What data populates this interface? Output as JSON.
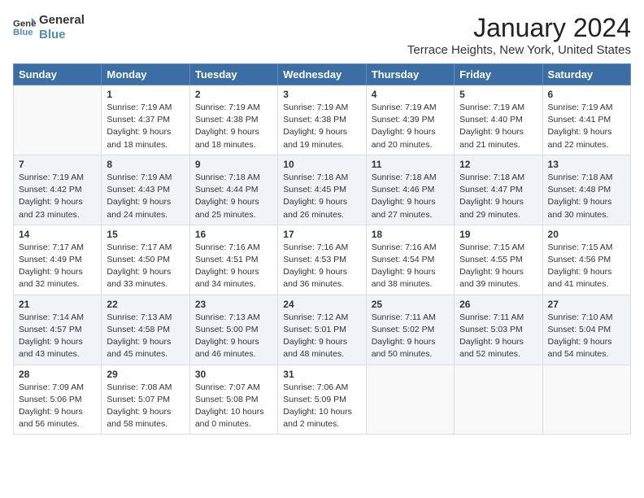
{
  "logo": {
    "line1": "General",
    "line2": "Blue"
  },
  "title": "January 2024",
  "location": "Terrace Heights, New York, United States",
  "weekdays": [
    "Sunday",
    "Monday",
    "Tuesday",
    "Wednesday",
    "Thursday",
    "Friday",
    "Saturday"
  ],
  "weeks": [
    [
      {
        "day": "",
        "info": ""
      },
      {
        "day": "1",
        "info": "Sunrise: 7:19 AM\nSunset: 4:37 PM\nDaylight: 9 hours\nand 18 minutes."
      },
      {
        "day": "2",
        "info": "Sunrise: 7:19 AM\nSunset: 4:38 PM\nDaylight: 9 hours\nand 18 minutes."
      },
      {
        "day": "3",
        "info": "Sunrise: 7:19 AM\nSunset: 4:38 PM\nDaylight: 9 hours\nand 19 minutes."
      },
      {
        "day": "4",
        "info": "Sunrise: 7:19 AM\nSunset: 4:39 PM\nDaylight: 9 hours\nand 20 minutes."
      },
      {
        "day": "5",
        "info": "Sunrise: 7:19 AM\nSunset: 4:40 PM\nDaylight: 9 hours\nand 21 minutes."
      },
      {
        "day": "6",
        "info": "Sunrise: 7:19 AM\nSunset: 4:41 PM\nDaylight: 9 hours\nand 22 minutes."
      }
    ],
    [
      {
        "day": "7",
        "info": "Sunrise: 7:19 AM\nSunset: 4:42 PM\nDaylight: 9 hours\nand 23 minutes."
      },
      {
        "day": "8",
        "info": "Sunrise: 7:19 AM\nSunset: 4:43 PM\nDaylight: 9 hours\nand 24 minutes."
      },
      {
        "day": "9",
        "info": "Sunrise: 7:18 AM\nSunset: 4:44 PM\nDaylight: 9 hours\nand 25 minutes."
      },
      {
        "day": "10",
        "info": "Sunrise: 7:18 AM\nSunset: 4:45 PM\nDaylight: 9 hours\nand 26 minutes."
      },
      {
        "day": "11",
        "info": "Sunrise: 7:18 AM\nSunset: 4:46 PM\nDaylight: 9 hours\nand 27 minutes."
      },
      {
        "day": "12",
        "info": "Sunrise: 7:18 AM\nSunset: 4:47 PM\nDaylight: 9 hours\nand 29 minutes."
      },
      {
        "day": "13",
        "info": "Sunrise: 7:18 AM\nSunset: 4:48 PM\nDaylight: 9 hours\nand 30 minutes."
      }
    ],
    [
      {
        "day": "14",
        "info": "Sunrise: 7:17 AM\nSunset: 4:49 PM\nDaylight: 9 hours\nand 32 minutes."
      },
      {
        "day": "15",
        "info": "Sunrise: 7:17 AM\nSunset: 4:50 PM\nDaylight: 9 hours\nand 33 minutes."
      },
      {
        "day": "16",
        "info": "Sunrise: 7:16 AM\nSunset: 4:51 PM\nDaylight: 9 hours\nand 34 minutes."
      },
      {
        "day": "17",
        "info": "Sunrise: 7:16 AM\nSunset: 4:53 PM\nDaylight: 9 hours\nand 36 minutes."
      },
      {
        "day": "18",
        "info": "Sunrise: 7:16 AM\nSunset: 4:54 PM\nDaylight: 9 hours\nand 38 minutes."
      },
      {
        "day": "19",
        "info": "Sunrise: 7:15 AM\nSunset: 4:55 PM\nDaylight: 9 hours\nand 39 minutes."
      },
      {
        "day": "20",
        "info": "Sunrise: 7:15 AM\nSunset: 4:56 PM\nDaylight: 9 hours\nand 41 minutes."
      }
    ],
    [
      {
        "day": "21",
        "info": "Sunrise: 7:14 AM\nSunset: 4:57 PM\nDaylight: 9 hours\nand 43 minutes."
      },
      {
        "day": "22",
        "info": "Sunrise: 7:13 AM\nSunset: 4:58 PM\nDaylight: 9 hours\nand 45 minutes."
      },
      {
        "day": "23",
        "info": "Sunrise: 7:13 AM\nSunset: 5:00 PM\nDaylight: 9 hours\nand 46 minutes."
      },
      {
        "day": "24",
        "info": "Sunrise: 7:12 AM\nSunset: 5:01 PM\nDaylight: 9 hours\nand 48 minutes."
      },
      {
        "day": "25",
        "info": "Sunrise: 7:11 AM\nSunset: 5:02 PM\nDaylight: 9 hours\nand 50 minutes."
      },
      {
        "day": "26",
        "info": "Sunrise: 7:11 AM\nSunset: 5:03 PM\nDaylight: 9 hours\nand 52 minutes."
      },
      {
        "day": "27",
        "info": "Sunrise: 7:10 AM\nSunset: 5:04 PM\nDaylight: 9 hours\nand 54 minutes."
      }
    ],
    [
      {
        "day": "28",
        "info": "Sunrise: 7:09 AM\nSunset: 5:06 PM\nDaylight: 9 hours\nand 56 minutes."
      },
      {
        "day": "29",
        "info": "Sunrise: 7:08 AM\nSunset: 5:07 PM\nDaylight: 9 hours\nand 58 minutes."
      },
      {
        "day": "30",
        "info": "Sunrise: 7:07 AM\nSunset: 5:08 PM\nDaylight: 10 hours\nand 0 minutes."
      },
      {
        "day": "31",
        "info": "Sunrise: 7:06 AM\nSunset: 5:09 PM\nDaylight: 10 hours\nand 2 minutes."
      },
      {
        "day": "",
        "info": ""
      },
      {
        "day": "",
        "info": ""
      },
      {
        "day": "",
        "info": ""
      }
    ]
  ]
}
